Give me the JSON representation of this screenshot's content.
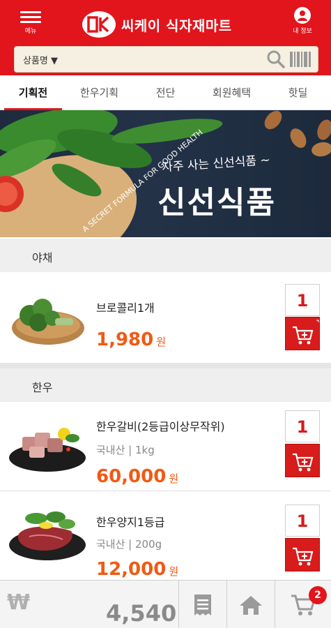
{
  "header": {
    "menu_label": "메뉴",
    "logo_text": "씨케이 식자재마트",
    "my_label": "내 정보"
  },
  "search": {
    "category": "상품명 ▼",
    "placeholder": ""
  },
  "tabs": [
    "기획전",
    "한우기획",
    "전단",
    "회원혜택",
    "핫딜"
  ],
  "banner": {
    "subtitle": "자주 사는 신선식품 ~",
    "title": "신선식품",
    "side_text": "A SECRET FORMULA FOR GOOD HEALTH"
  },
  "sections": [
    {
      "title": "야채",
      "items": [
        {
          "name": "브로콜리1개",
          "meta": "",
          "price": "1,980",
          "unit": "원",
          "qty": "1",
          "image": "broccoli"
        }
      ]
    },
    {
      "title": "한우",
      "items": [
        {
          "name": "한우갈비(2등급이상무작위)",
          "meta": "국내산 | 1kg",
          "price": "60,000",
          "unit": "원",
          "qty": "1",
          "image": "beef-ribs"
        },
        {
          "name": "한우양지1등급",
          "meta": "국내산 | 200g",
          "price": "12,000",
          "unit": "원",
          "qty": "1",
          "image": "beef-brisket"
        }
      ]
    }
  ],
  "bottom": {
    "currency": "₩",
    "total": "4,540",
    "cart_count": "2",
    "icons": [
      "receipt-icon",
      "home-icon",
      "cart-icon"
    ]
  },
  "colors": {
    "brand": "#e2141c",
    "price": "#f05a14",
    "cart": "#d81b1b"
  }
}
